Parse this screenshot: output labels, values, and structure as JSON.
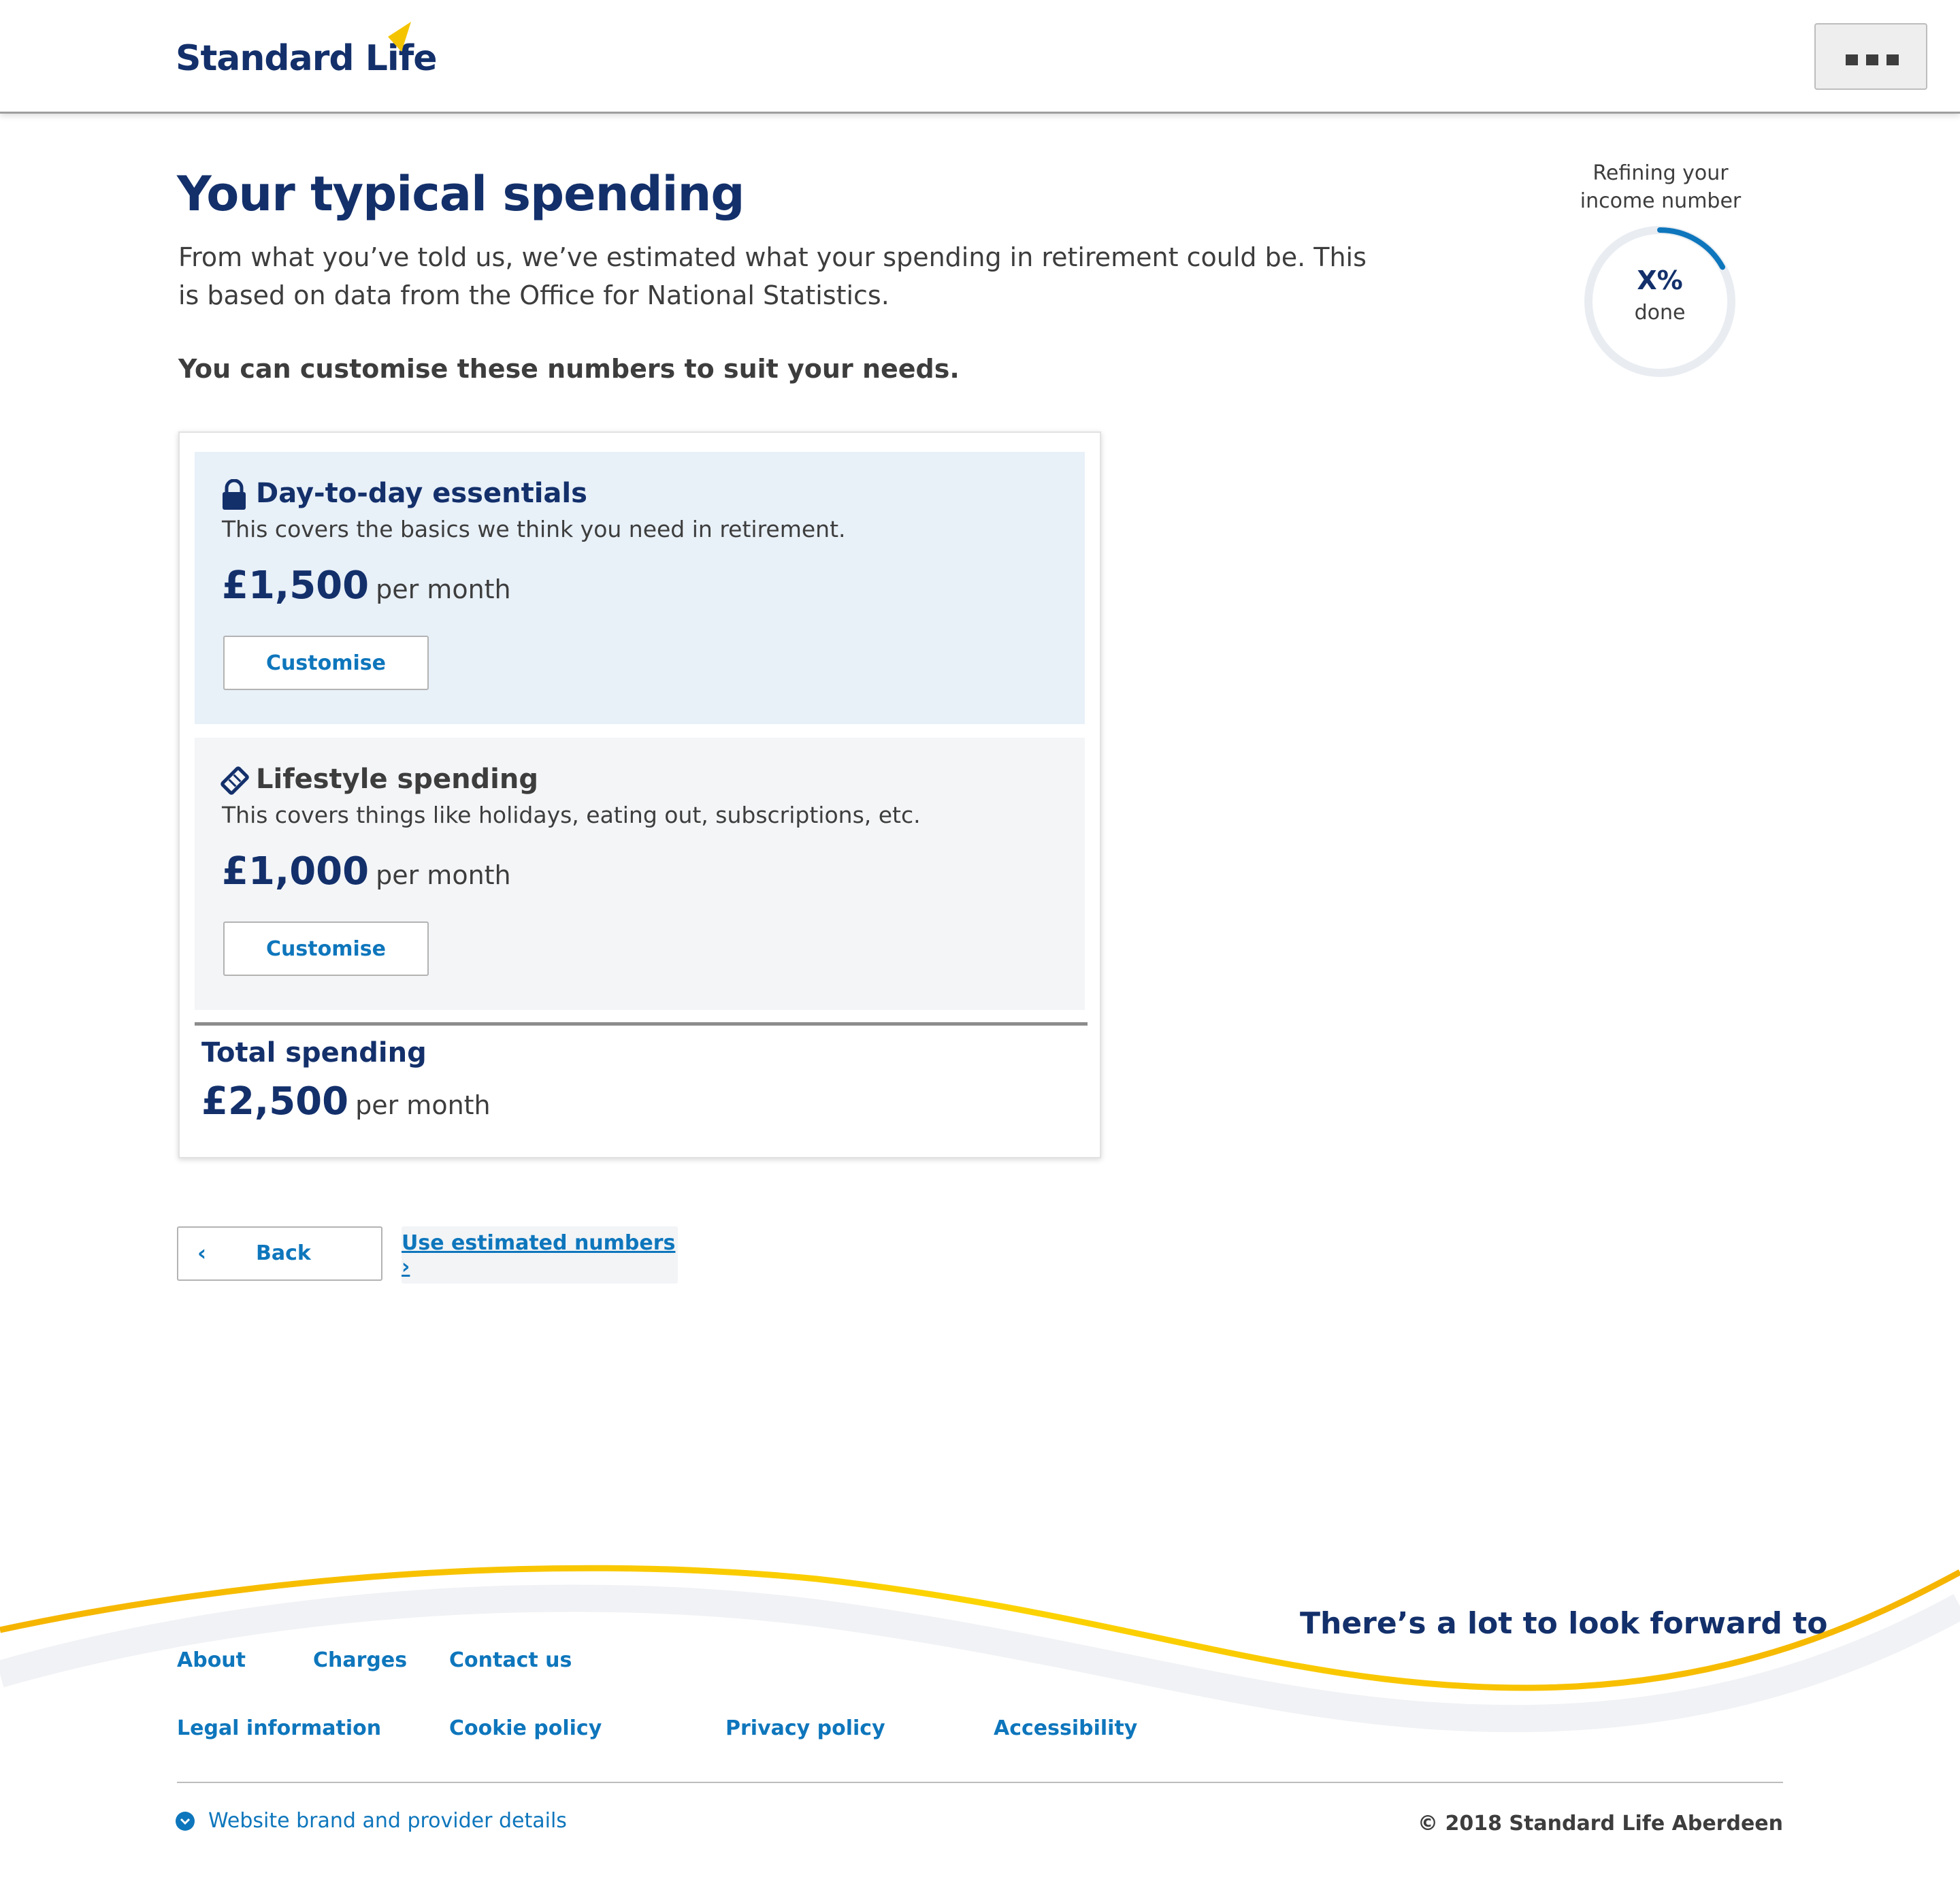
{
  "header": {
    "logo_text": "Standard Life",
    "menu_icon": "more-dots-icon"
  },
  "intro": {
    "title": "Your typical spending",
    "description": "From what you’ve told us, we’ve estimated what your spending in retirement could be. This is based on data from the Office for National Statistics.",
    "customise_note": "You can customise these numbers to suit your needs."
  },
  "progress": {
    "label": "Refining your income number",
    "value_text": "X%",
    "done_label": "done",
    "fraction_filled": 0.17
  },
  "spending": {
    "essentials": {
      "icon": "lock-icon",
      "title": "Day-to-day essentials",
      "description": "This covers the basics we think you need in retirement.",
      "amount": "£1,500",
      "period": "per month",
      "button": "Customise"
    },
    "lifestyle": {
      "icon": "ticket-icon",
      "title": "Lifestyle spending",
      "description": "This covers things like holidays, eating out, subscriptions, etc.",
      "amount": "£1,000",
      "period": "per month",
      "button": "Customise"
    },
    "total": {
      "label": "Total spending",
      "amount": "£2,500",
      "period": "per month"
    }
  },
  "actions": {
    "back_chevron": "‹",
    "back_label": "Back",
    "next_label": "Use estimated numbers ›"
  },
  "footer": {
    "tagline": "There’s a lot to look forward to",
    "links_row1": [
      "About",
      "Charges",
      "Contact us"
    ],
    "links_row2": [
      "Legal information",
      "Cookie policy",
      "Privacy policy",
      "Accessibility"
    ],
    "brand_details": "Website brand and provider details",
    "copyright": "© 2018 Standard Life Aberdeen"
  },
  "colors": {
    "brand_navy": "#13306b",
    "link_blue": "#0e76bc",
    "accent_yellow": "#f5c400",
    "essentials_bg": "#e8f0f8",
    "lifestyle_bg": "#f3f5f7"
  }
}
